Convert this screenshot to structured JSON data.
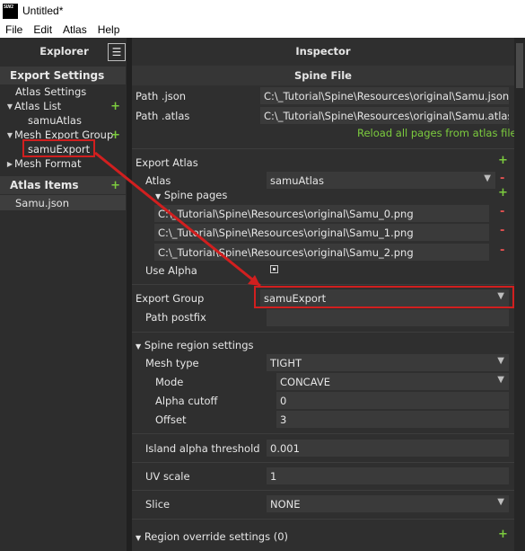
{
  "window": {
    "title": "Untitled*",
    "logo_text": "SUV2"
  },
  "menu": [
    "File",
    "Edit",
    "Atlas",
    "Help"
  ],
  "explorer": {
    "title": "Explorer",
    "export_settings": "Export Settings",
    "atlas_settings": "Atlas Settings",
    "atlas_list": "Atlas List",
    "atlas_item": "samuAtlas",
    "mesh_export_group": "Mesh Export Group",
    "export_item": "samuExport",
    "mesh_format": "Mesh Format",
    "atlas_items": "Atlas Items",
    "atlas_file": "Samu.json",
    "plus": "+"
  },
  "inspector": {
    "title": "Inspector",
    "section": "Spine File",
    "path_json_label": "Path .json",
    "path_json": "C:\\_Tutorial\\Spine\\Resources\\original\\Samu.json",
    "path_atlas_label": "Path .atlas",
    "path_atlas": "C:\\_Tutorial\\Spine\\Resources\\original\\Samu.atlas.t",
    "reload": "Reload all pages from atlas file",
    "export_atlas": "Export Atlas",
    "atlas_label": "Atlas",
    "atlas_value": "samuAtlas",
    "spine_pages": "Spine pages",
    "pages": [
      "C:\\_Tutorial\\Spine\\Resources\\original\\Samu_0.png",
      "C:\\_Tutorial\\Spine\\Resources\\original\\Samu_1.png",
      "C:\\_Tutorial\\Spine\\Resources\\original\\Samu_2.png"
    ],
    "use_alpha": "Use Alpha",
    "export_group_label": "Export Group",
    "export_group_value": "samuExport",
    "path_postfix": "Path postfix",
    "region_settings": "Spine region settings",
    "mesh_type_label": "Mesh type",
    "mesh_type_value": "TIGHT",
    "mode_label": "Mode",
    "mode_value": "CONCAVE",
    "alpha_cutoff_label": "Alpha cutoff",
    "alpha_cutoff_value": "0",
    "offset_label": "Offset",
    "offset_value": "3",
    "island_label": "Island alpha threshold",
    "island_value": "0.001",
    "uv_scale_label": "UV scale",
    "uv_scale_value": "1",
    "slice_label": "Slice",
    "slice_value": "NONE",
    "region_override": "Region override settings (0)",
    "plus": "+",
    "minus": "-"
  },
  "colors": {
    "accent_green": "#7ccc3e",
    "remove_red": "#e05050",
    "annotation_red": "#d11f1f"
  }
}
